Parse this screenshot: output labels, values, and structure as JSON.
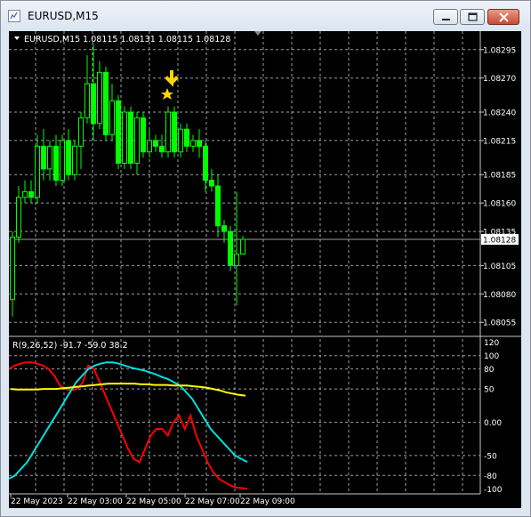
{
  "window": {
    "title": "EURUSD,M15"
  },
  "chart_info": "EURUSD,M15  1.08115 1.08131 1.08115 1.08128",
  "price_axis": {
    "ticks": [
      "1.08295",
      "1.08270",
      "1.08240",
      "1.08215",
      "1.08185",
      "1.08160",
      "1.08135",
      "1.08105",
      "1.08080",
      "1.08055"
    ],
    "tick_values": [
      1.08295,
      1.0827,
      1.0824,
      1.08215,
      1.08185,
      1.0816,
      1.08135,
      1.08105,
      1.0808,
      1.08055
    ],
    "current_price": "1.08128"
  },
  "indicator": {
    "label": "R(9,26,52) -91.7 -59.0 38.2",
    "ticks": [
      "120",
      "100",
      "80",
      "50",
      "0.00",
      "-50",
      "-80",
      "-100"
    ],
    "tick_values": [
      120,
      100,
      80,
      50,
      0,
      -50,
      -80,
      -100
    ]
  },
  "time_axis": {
    "labels": [
      "22 May 2023",
      "22 May 03:00",
      "22 May 05:00",
      "22 May 07:00",
      "22 May 09:00"
    ]
  },
  "colors": {
    "bull": "#00ff00",
    "bear": "#00ff00",
    "fast": "#ff0000",
    "mid": "#00e0e0",
    "slow": "#ffff00",
    "grid": "#9aa0a6",
    "arrow": "#ffd700"
  },
  "markers": {
    "arrow_icon": "down-arrow-icon",
    "star_icon": "star-icon"
  },
  "chart_data": [
    {
      "type": "candlestick",
      "ylim": [
        1.08045,
        1.08305
      ],
      "candles": [
        {
          "o": 1.08075,
          "h": 1.08135,
          "l": 1.0806,
          "c": 1.0813
        },
        {
          "o": 1.0813,
          "h": 1.08175,
          "l": 1.08125,
          "c": 1.08165
        },
        {
          "o": 1.08165,
          "h": 1.0818,
          "l": 1.0816,
          "c": 1.0817
        },
        {
          "o": 1.0817,
          "h": 1.0818,
          "l": 1.0816,
          "c": 1.08165
        },
        {
          "o": 1.08165,
          "h": 1.0822,
          "l": 1.0816,
          "c": 1.0821
        },
        {
          "o": 1.0821,
          "h": 1.08225,
          "l": 1.0818,
          "c": 1.0819
        },
        {
          "o": 1.0819,
          "h": 1.08215,
          "l": 1.0818,
          "c": 1.0821
        },
        {
          "o": 1.0821,
          "h": 1.0822,
          "l": 1.08175,
          "c": 1.0818
        },
        {
          "o": 1.0818,
          "h": 1.0822,
          "l": 1.08175,
          "c": 1.08215
        },
        {
          "o": 1.08215,
          "h": 1.08225,
          "l": 1.0818,
          "c": 1.08185
        },
        {
          "o": 1.08185,
          "h": 1.08215,
          "l": 1.0818,
          "c": 1.0821
        },
        {
          "o": 1.0821,
          "h": 1.0824,
          "l": 1.0819,
          "c": 1.08235
        },
        {
          "o": 1.08235,
          "h": 1.0829,
          "l": 1.0823,
          "c": 1.08265
        },
        {
          "o": 1.08265,
          "h": 1.083,
          "l": 1.08215,
          "c": 1.0823
        },
        {
          "o": 1.0823,
          "h": 1.08285,
          "l": 1.08225,
          "c": 1.08275
        },
        {
          "o": 1.08275,
          "h": 1.0828,
          "l": 1.08215,
          "c": 1.0822
        },
        {
          "o": 1.0822,
          "h": 1.08265,
          "l": 1.08215,
          "c": 1.0825
        },
        {
          "o": 1.0825,
          "h": 1.08255,
          "l": 1.0819,
          "c": 1.08195
        },
        {
          "o": 1.08195,
          "h": 1.08245,
          "l": 1.0819,
          "c": 1.0824
        },
        {
          "o": 1.0824,
          "h": 1.08245,
          "l": 1.0819,
          "c": 1.08195
        },
        {
          "o": 1.08195,
          "h": 1.0824,
          "l": 1.08185,
          "c": 1.08235
        },
        {
          "o": 1.08235,
          "h": 1.0824,
          "l": 1.082,
          "c": 1.08205
        },
        {
          "o": 1.08205,
          "h": 1.08225,
          "l": 1.082,
          "c": 1.08215
        },
        {
          "o": 1.08215,
          "h": 1.0822,
          "l": 1.08205,
          "c": 1.0821
        },
        {
          "o": 1.0821,
          "h": 1.0822,
          "l": 1.082,
          "c": 1.08205
        },
        {
          "o": 1.08205,
          "h": 1.08245,
          "l": 1.082,
          "c": 1.0824
        },
        {
          "o": 1.0824,
          "h": 1.08245,
          "l": 1.082,
          "c": 1.08205
        },
        {
          "o": 1.08205,
          "h": 1.0823,
          "l": 1.082,
          "c": 1.08225
        },
        {
          "o": 1.08225,
          "h": 1.0823,
          "l": 1.08205,
          "c": 1.0821
        },
        {
          "o": 1.0821,
          "h": 1.0822,
          "l": 1.08205,
          "c": 1.08215
        },
        {
          "o": 1.08215,
          "h": 1.08225,
          "l": 1.082,
          "c": 1.0821
        },
        {
          "o": 1.0821,
          "h": 1.08215,
          "l": 1.0817,
          "c": 1.0818
        },
        {
          "o": 1.0818,
          "h": 1.0819,
          "l": 1.0817,
          "c": 1.08175
        },
        {
          "o": 1.08175,
          "h": 1.08185,
          "l": 1.0813,
          "c": 1.0814
        },
        {
          "o": 1.0814,
          "h": 1.08145,
          "l": 1.08125,
          "c": 1.08135
        },
        {
          "o": 1.08135,
          "h": 1.0814,
          "l": 1.081,
          "c": 1.08105
        },
        {
          "o": 1.08105,
          "h": 1.0817,
          "l": 1.0807,
          "c": 1.08115
        },
        {
          "o": 1.08115,
          "h": 1.08131,
          "l": 1.08115,
          "c": 1.08128
        }
      ]
    },
    {
      "type": "line",
      "ylim": [
        -105,
        125
      ],
      "series": [
        {
          "color": "#ff0000",
          "values": [
            80,
            85,
            88,
            90,
            90,
            88,
            85,
            80,
            70,
            55,
            50,
            48,
            50,
            60,
            85,
            80,
            60,
            40,
            20,
            0,
            -20,
            -40,
            -55,
            -60,
            -40,
            -20,
            -10,
            -10,
            -20,
            0,
            10,
            -10,
            10,
            -20,
            -40,
            -60,
            -75,
            -85,
            -90,
            -95,
            -98,
            -99,
            -100
          ]
        },
        {
          "color": "#00e0e0",
          "values": [
            -85,
            -80,
            -70,
            -60,
            -45,
            -30,
            -15,
            0,
            15,
            30,
            45,
            60,
            70,
            80,
            85,
            88,
            90,
            90,
            88,
            85,
            82,
            80,
            78,
            75,
            72,
            68,
            65,
            60,
            55,
            45,
            35,
            20,
            5,
            -10,
            -20,
            -30,
            -40,
            -50,
            -55,
            -60
          ]
        },
        {
          "color": "#ffff00",
          "values": [
            50,
            49,
            49,
            49,
            49,
            50,
            50,
            50,
            51,
            52,
            53,
            54,
            55,
            56,
            57,
            58,
            58,
            58,
            58,
            58,
            57,
            57,
            56,
            56,
            56,
            55,
            55,
            55,
            54,
            53,
            52,
            50,
            48,
            45,
            43,
            41,
            40
          ]
        }
      ]
    }
  ]
}
